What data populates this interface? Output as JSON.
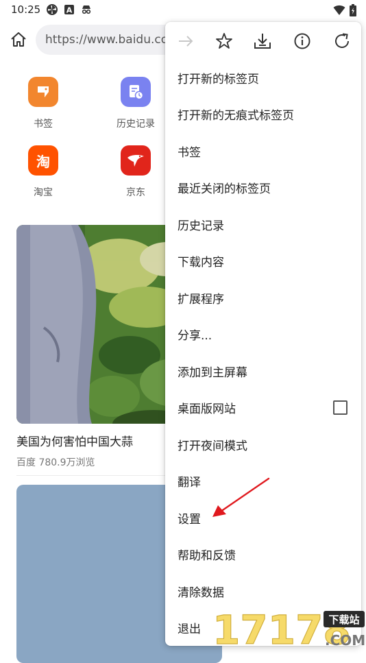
{
  "status_bar": {
    "time": "10:25",
    "icons": [
      "pinwheel-icon",
      "a-square-icon",
      "incognito-icon"
    ],
    "right_icons": [
      "wifi-icon",
      "battery-icon"
    ]
  },
  "toolbar": {
    "url": "https://www.baidu.com"
  },
  "speed_dial": [
    {
      "label": "书签",
      "color": "#f2862e"
    },
    {
      "label": "历史记录",
      "color": "#7a82f0"
    },
    {
      "label": "淘宝",
      "color": "#ff5200",
      "glyph": "淘"
    },
    {
      "label": "京东",
      "color": "#e1251b"
    }
  ],
  "feed": {
    "title": "美国为何害怕中国大蒜",
    "meta": "百度  780.9万浏览"
  },
  "menu": {
    "top_icons": [
      "forward-icon",
      "bookmark-star-icon",
      "download-icon",
      "info-icon",
      "refresh-icon"
    ],
    "items": [
      {
        "label": "打开新的标签页"
      },
      {
        "label": "打开新的无痕式标签页"
      },
      {
        "label": "书签"
      },
      {
        "label": "最近关闭的标签页"
      },
      {
        "label": "历史记录"
      },
      {
        "label": "下载内容"
      },
      {
        "label": "扩展程序"
      },
      {
        "label": "分享..."
      },
      {
        "label": "添加到主屏幕"
      },
      {
        "label": "桌面版网站",
        "checkbox": false
      },
      {
        "label": "打开夜间模式"
      },
      {
        "label": "翻译"
      },
      {
        "label": "设置"
      },
      {
        "label": "帮助和反馈"
      },
      {
        "label": "清除数据"
      },
      {
        "label": "退出"
      }
    ]
  },
  "annotation": {
    "color": "#e0191e"
  },
  "watermark": {
    "text": "17178",
    "badge": "下载站",
    "suffix": ".COM"
  }
}
